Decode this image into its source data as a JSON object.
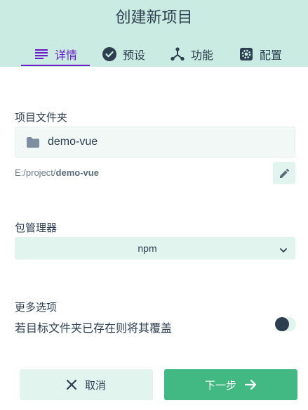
{
  "header": {
    "title": "创建新项目",
    "tabs": [
      {
        "label": "详情",
        "icon": "list-icon",
        "active": true
      },
      {
        "label": "预设",
        "icon": "check-circle-icon",
        "active": false
      },
      {
        "label": "功能",
        "icon": "feature-nodes-icon",
        "active": false
      },
      {
        "label": "配置",
        "icon": "gear-icon",
        "active": false
      }
    ]
  },
  "folder": {
    "label": "项目文件夹",
    "value": "demo-vue",
    "icon": "folder-icon",
    "path_prefix": "E:/project/",
    "path_name": "demo-vue"
  },
  "package_manager": {
    "label": "包管理器",
    "selected": "npm"
  },
  "more_options": {
    "label": "更多选项",
    "overwrite_label": "若目标文件夹已存在则将其覆盖",
    "overwrite_enabled": false
  },
  "actions": {
    "cancel_label": "取消",
    "next_label": "下一步"
  },
  "colors": {
    "accent": "#42b983",
    "header_bg": "#c9ebe1",
    "active_tab": "#6a1fc9",
    "text": "#2c3e50"
  }
}
